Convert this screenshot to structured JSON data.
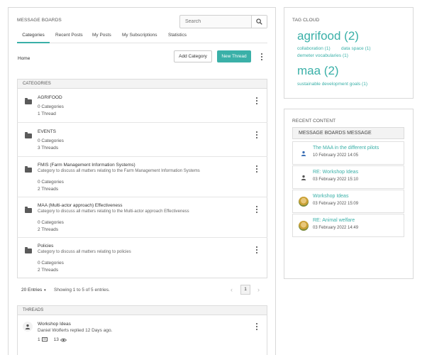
{
  "header": {
    "title": "MESSAGE BOARDS",
    "search_placeholder": "Search"
  },
  "tabs": [
    {
      "label": "Categories",
      "active": true
    },
    {
      "label": "Recent Posts"
    },
    {
      "label": "My Posts"
    },
    {
      "label": "My Subscriptions"
    },
    {
      "label": "Statistics"
    }
  ],
  "toolbar": {
    "breadcrumb": "Home",
    "add_category": "Add Category",
    "new_thread": "New Thread"
  },
  "categories": {
    "header": "CATEGORIES",
    "items": [
      {
        "name": "AGRIFOOD",
        "description": "",
        "categories": "0 Categories",
        "threads": "1 Thread"
      },
      {
        "name": "EVENTS",
        "description": "",
        "categories": "0 Categories",
        "threads": "3 Threads"
      },
      {
        "name": "FMIS (Farm Management Information Systems)",
        "description": "Category to discuss all matters relating to the Farm Management Information Systems",
        "categories": "0 Categories",
        "threads": "2 Threads"
      },
      {
        "name": "MAA (Multi-actor approach) Effectiveness",
        "description": "Category to discuss all matters relating to the Multi-actor approach Effectiveness",
        "categories": "0 Categories",
        "threads": "2 Threads"
      },
      {
        "name": "Policies",
        "description": "Category to discuss all matters relating to policies",
        "categories": "0 Categories",
        "threads": "2 Threads"
      }
    ]
  },
  "pagination": {
    "per_page": "20 Entries",
    "summary": "Showing 1 to 5 of 5 entries.",
    "current_page": "1"
  },
  "threads": {
    "header": "THREADS",
    "items": [
      {
        "title": "Workshop Ideas",
        "subtitle": "Daniel Wolferts replied 12 Days ago.",
        "replies": "1",
        "views": "13"
      }
    ]
  },
  "tag_cloud": {
    "title": "TAG CLOUD",
    "tags": [
      {
        "label": "agrifood (2)",
        "size": "large"
      },
      {
        "label": "collaboration (1)",
        "size": "small"
      },
      {
        "label": "data space (1)",
        "size": "small"
      },
      {
        "label": "demeter vocabularies (1)",
        "size": "small"
      },
      {
        "label": "maa (2)",
        "size": "large"
      },
      {
        "label": "sustainable development goals (1)",
        "size": "small"
      }
    ]
  },
  "recent_content": {
    "title": "RECENT CONTENT",
    "header": "MESSAGE BOARDS MESSAGE",
    "items": [
      {
        "title": "The MAA in the different pilots",
        "date": "10 February 2022 14:05",
        "avatar": "user-icon"
      },
      {
        "title": "RE: Workshop Ideas",
        "date": "03 February 2022 15:10",
        "avatar": "user-icon"
      },
      {
        "title": "Workshop Ideas",
        "date": "03 February 2022 15:09",
        "avatar": "photo-avatar"
      },
      {
        "title": "RE: Animal welfare",
        "date": "03 February 2022 14:49",
        "avatar": "photo-avatar"
      }
    ]
  },
  "colors": {
    "accent": "#3ab0a8",
    "border": "#d9d9d9",
    "header_bg": "#f3f3f3"
  }
}
